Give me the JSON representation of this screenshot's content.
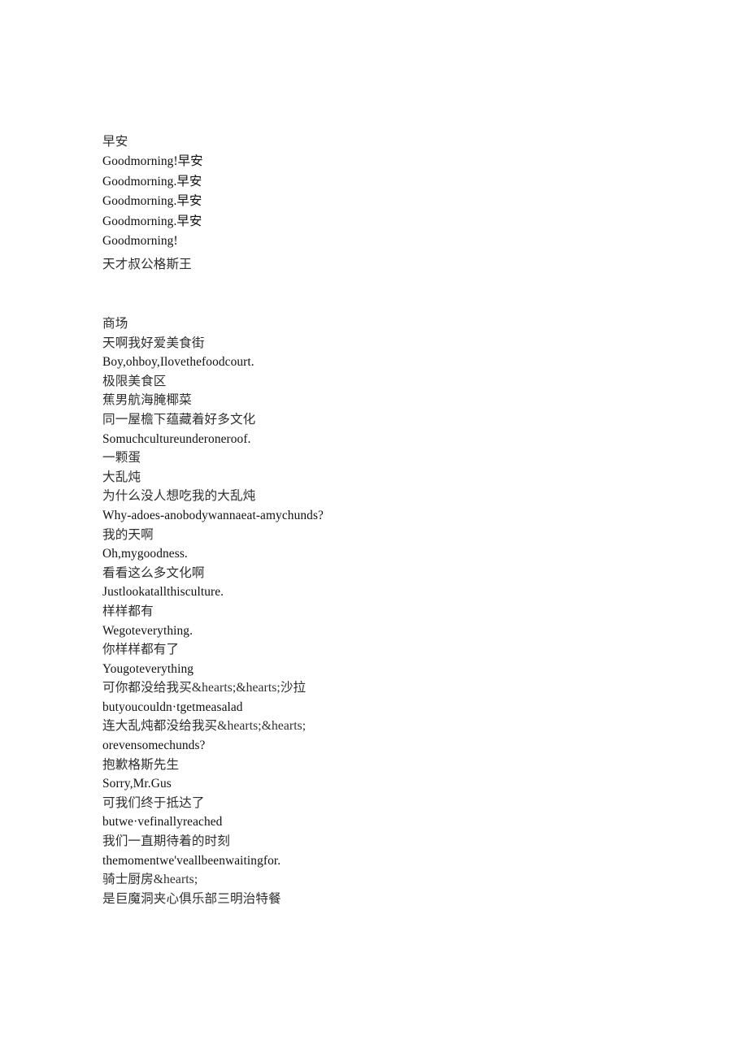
{
  "document": {
    "background_color": "#ffffff",
    "text_color": "#151515",
    "cjk_text_color": "#2e2e2e"
  },
  "blocks": [
    {
      "id": "greeting",
      "lines": [
        {
          "text": "早安",
          "script": "cjk"
        },
        {
          "text": "Goodmorning!早安",
          "script": "latin"
        },
        {
          "text": "Goodmorning.早安",
          "script": "latin"
        },
        {
          "text": "Goodmorning.早安",
          "script": "latin"
        },
        {
          "text": "Goodmorning.早安",
          "script": "latin"
        },
        {
          "text": "Goodmorning!",
          "script": "latin"
        },
        {
          "text": "天才叔公格斯王",
          "script": "cjk"
        }
      ]
    },
    {
      "id": "mall",
      "lines": [
        {
          "text": "商场",
          "script": "cjk"
        },
        {
          "text": "天啊我好爱美食街",
          "script": "cjk"
        },
        {
          "text": "Boy,ohboy,Ilovethefoodcourt.",
          "script": "latin"
        },
        {
          "text": "极限美食区",
          "script": "cjk"
        },
        {
          "text": "蕉男航海腌椰菜",
          "script": "cjk"
        },
        {
          "text": "同一屋檐下蕴藏着好多文化",
          "script": "cjk"
        },
        {
          "text": "Somuchcultureunderoneroof.",
          "script": "latin"
        },
        {
          "text": "一颗蛋",
          "script": "cjk"
        },
        {
          "text": "大乱炖",
          "script": "cjk"
        },
        {
          "text": "为什么没人想吃我的大乱炖",
          "script": "cjk"
        },
        {
          "text": "Why-adoes-anobodywannaeat-amychunds?",
          "script": "latin"
        },
        {
          "text": "我的天啊",
          "script": "cjk"
        },
        {
          "text": "Oh,mygoodness.",
          "script": "latin"
        },
        {
          "text": "看看这么多文化啊",
          "script": "cjk"
        },
        {
          "text": "Justlookatallthisculture.",
          "script": "latin"
        },
        {
          "text": "样样都有",
          "script": "cjk"
        },
        {
          "text": "Wegoteverything.",
          "script": "latin"
        },
        {
          "text": "你样样都有了",
          "script": "cjk"
        },
        {
          "text": "Yougoteverything",
          "script": "latin"
        },
        {
          "text": "可你都没给我买&hearts;&hearts;沙拉",
          "script": "cjk"
        },
        {
          "text": "butyoucouldn·tgetmeasalad",
          "script": "latin"
        },
        {
          "text": "连大乱炖都没给我买&hearts;&hearts;",
          "script": "cjk"
        },
        {
          "text": "orevensomechunds?",
          "script": "latin"
        },
        {
          "text": "抱歉格斯先生",
          "script": "cjk"
        },
        {
          "text": "Sorry,Mr.Gus",
          "script": "latin"
        },
        {
          "text": "可我们终于抵达了",
          "script": "cjk"
        },
        {
          "text": "butwe·vefinallyreached",
          "script": "latin"
        },
        {
          "text": "我们一直期待着的时刻",
          "script": "cjk"
        },
        {
          "text": "themomentwe'veallbeenwaitingfor.",
          "script": "latin"
        },
        {
          "text": "骑士厨房&hearts;",
          "script": "cjk"
        },
        {
          "text": "是巨魔洞夹心俱乐部三明治特餐",
          "script": "cjk"
        }
      ]
    }
  ]
}
